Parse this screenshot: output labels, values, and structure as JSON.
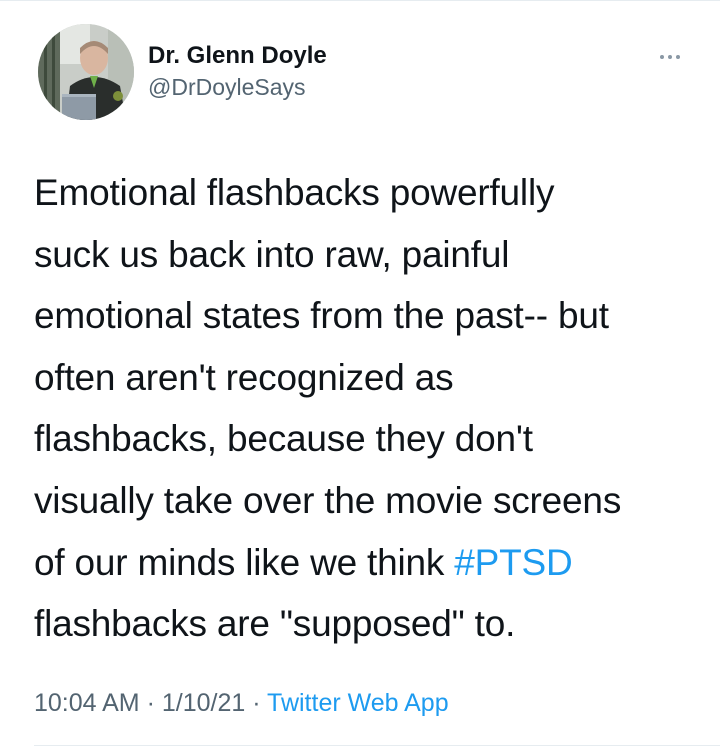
{
  "tweet": {
    "author": {
      "display_name": "Dr. Glenn Doyle",
      "handle": "@DrDoyleSays"
    },
    "more_icon": "more-horizontal-icon",
    "text_lines": [
      "Emotional flashbacks powerfully",
      "suck us back into raw, painful",
      "emotional states from the past-- but",
      "often aren't recognized as",
      "flashbacks, because they don't",
      "visually take over the movie screens",
      "of our minds like we think "
    ],
    "hashtag": "#PTSD",
    "last_line": "flashbacks are \"supposed\" to.",
    "meta": {
      "time": "10:04 AM",
      "separator": " · ",
      "date": "1/10/21",
      "source": "Twitter Web App"
    },
    "colors": {
      "link": "#1d9bf0",
      "secondary_text": "#536471",
      "primary_text": "#0f1419"
    }
  }
}
